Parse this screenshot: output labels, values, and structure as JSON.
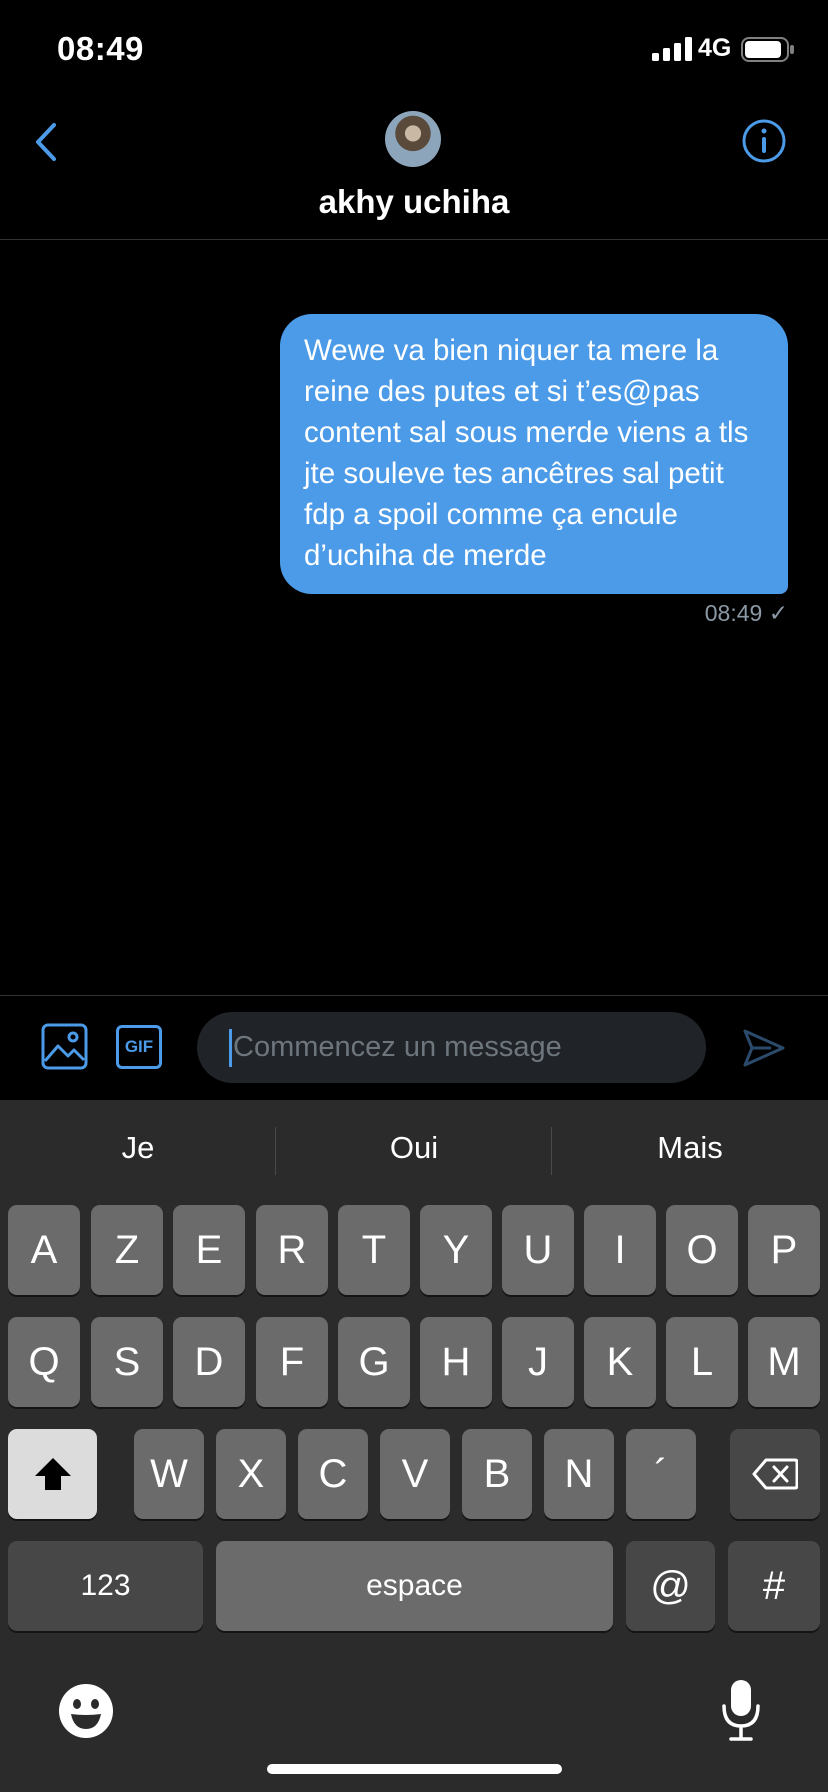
{
  "status_bar": {
    "time": "08:49",
    "network": "4G"
  },
  "header": {
    "contact_name": "akhy uchiha"
  },
  "conversation": {
    "messages": [
      {
        "text": "Wewe va bien niquer ta mere la reine des putes et si t’es@pas content sal sous merde viens a tls jte souleve tes ancêtres sal petit fdp a spoil comme ça encule d’uchiha de merde",
        "time": "08:49",
        "status": "✓"
      }
    ]
  },
  "composer": {
    "placeholder": "Commencez un message",
    "gif_label": "GIF"
  },
  "keyboard": {
    "suggestions": [
      "Je",
      "Oui",
      "Mais"
    ],
    "row1": [
      "A",
      "Z",
      "E",
      "R",
      "T",
      "Y",
      "U",
      "I",
      "O",
      "P"
    ],
    "row2": [
      "Q",
      "S",
      "D",
      "F",
      "G",
      "H",
      "J",
      "K",
      "L",
      "M"
    ],
    "row3": [
      "W",
      "X",
      "C",
      "V",
      "B",
      "N",
      "´"
    ],
    "numbers_label": "123",
    "space_label": "espace",
    "at_label": "@",
    "hash_label": "#"
  },
  "colors": {
    "accent": "#4c9be8",
    "background": "#000000",
    "keyboard": "#2b2b2b"
  },
  "icons": [
    "back-chevron",
    "info",
    "image",
    "gif",
    "send",
    "shift",
    "backspace",
    "emoji",
    "microphone"
  ]
}
